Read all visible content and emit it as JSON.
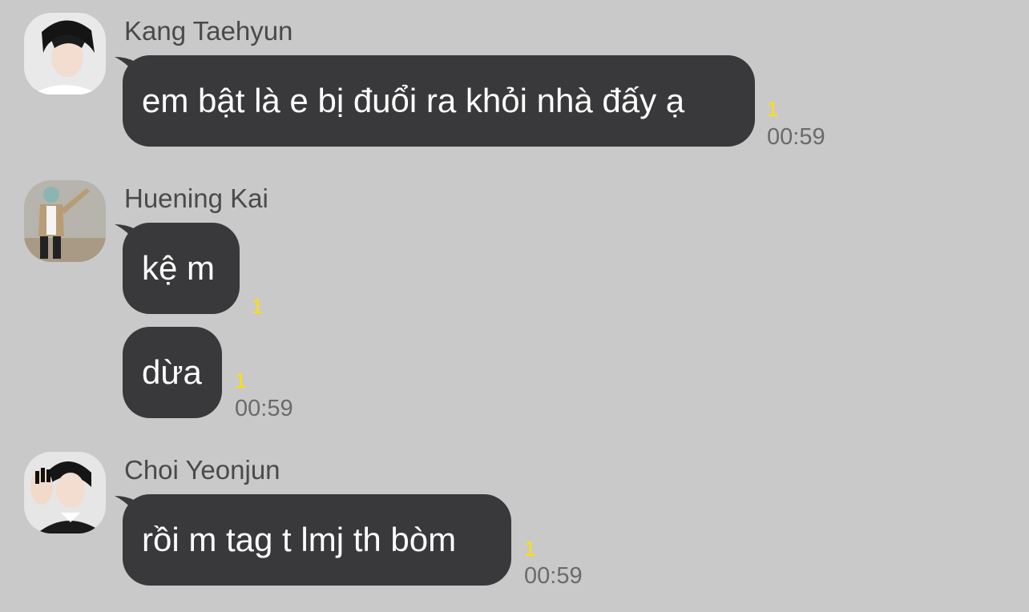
{
  "messages": [
    {
      "sender": "Kang Taehyun",
      "avatar_icon": "profile-photo-icon",
      "bubbles": [
        {
          "text": "em bật là e bị đuổi ra khỏi nhà đấy ạ",
          "unread": "1",
          "time": "00:59"
        }
      ]
    },
    {
      "sender": "Huening Kai",
      "avatar_icon": "profile-photo-icon",
      "bubbles": [
        {
          "text": "kệ m",
          "unread": "1",
          "time": ""
        },
        {
          "text": "dừa",
          "unread": "1",
          "time": "00:59"
        }
      ]
    },
    {
      "sender": "Choi Yeonjun",
      "avatar_icon": "profile-photo-icon",
      "bubbles": [
        {
          "text": "rồi m tag t lmj th bòm",
          "unread": "1",
          "time": "00:59"
        }
      ]
    }
  ],
  "colors": {
    "background": "#c9c9c9",
    "bubble": "#39393b",
    "unread": "#ffe000",
    "time": "#6a6a6a",
    "name": "#4a4a4a"
  }
}
